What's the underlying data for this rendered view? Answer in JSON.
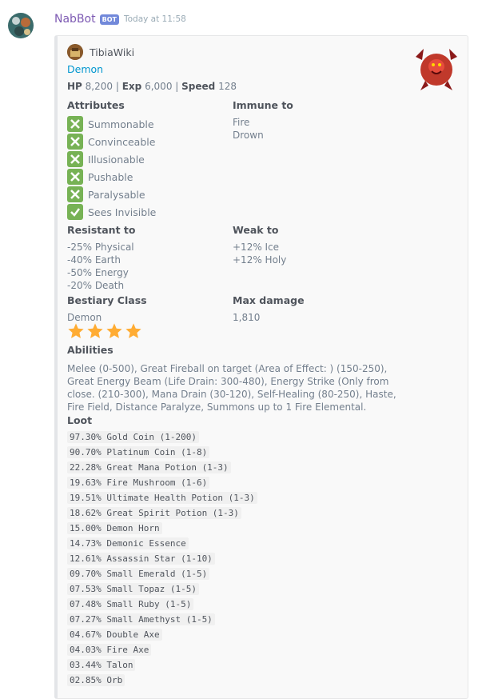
{
  "message": {
    "username": "NabBot",
    "bot_tag": "BOT",
    "timestamp": "Today at 11:58"
  },
  "embed": {
    "author": "TibiaWiki",
    "title": "Demon",
    "stats": {
      "hp_label": "HP",
      "hp": "8,200",
      "exp_label": "Exp",
      "exp": "6,000",
      "speed_label": "Speed",
      "speed": "128",
      "sep": "|"
    },
    "attributes": {
      "name": "Attributes",
      "items": [
        {
          "label": "Summonable",
          "state": "cross"
        },
        {
          "label": "Convinceable",
          "state": "cross"
        },
        {
          "label": "Illusionable",
          "state": "cross"
        },
        {
          "label": "Pushable",
          "state": "cross"
        },
        {
          "label": "Paralysable",
          "state": "cross"
        },
        {
          "label": "Sees Invisible",
          "state": "check"
        }
      ]
    },
    "immune": {
      "name": "Immune to",
      "values": [
        "Fire",
        "Drown"
      ]
    },
    "resistant": {
      "name": "Resistant to",
      "values": [
        "-25% Physical",
        "-40% Earth",
        "-50% Energy",
        "-20% Death"
      ]
    },
    "weak": {
      "name": "Weak to",
      "values": [
        "+12% Ice",
        "+12% Holy"
      ]
    },
    "bestiary": {
      "name": "Bestiary Class",
      "value": "Demon",
      "stars": 4
    },
    "max_damage": {
      "name": "Max damage",
      "value": "1,810"
    },
    "abilities": {
      "name": "Abilities",
      "text": "Melee (0-500), Great Fireball on target (Area of Effect: ) (150-250), Great Energy Beam (Life Drain: 300-480), Energy Strike (Only from close. (210-300), Mana Drain (30-120), Self-Healing (80-250), Haste, Fire Field, Distance Paralyze, Summons up to 1 Fire Elemental."
    },
    "loot": {
      "name": "Loot",
      "items": [
        "97.30% Gold Coin (1-200)",
        "90.70% Platinum Coin (1-8)",
        "22.28% Great Mana Potion (1-3)",
        "19.63% Fire Mushroom (1-6)",
        "19.51% Ultimate Health Potion (1-3)",
        "18.62% Great Spirit Potion (1-3)",
        "15.00% Demon Horn",
        "14.73% Demonic Essence",
        "12.61% Assassin Star (1-10)",
        "09.70% Small Emerald (1-5)",
        "07.53% Small Topaz (1-5)",
        "07.48% Small Ruby (1-5)",
        "07.27% Small Amethyst (1-5)",
        "04.67% Double Axe",
        "04.03% Fire Axe",
        "03.44% Talon",
        "02.85% Orb"
      ]
    }
  },
  "colors": {
    "username": "#7d5ab3",
    "bot_tag": "#7289da",
    "title_link": "#0096cf",
    "check_box": "#77b255",
    "star": "#ffac33"
  },
  "icons": {
    "avatar": "nabbot-avatar-icon",
    "author": "tibiawiki-icon",
    "thumbnail": "demon-thumbnail-icon",
    "cross": "cross-mark-icon",
    "check": "check-mark-icon",
    "star": "star-icon"
  }
}
